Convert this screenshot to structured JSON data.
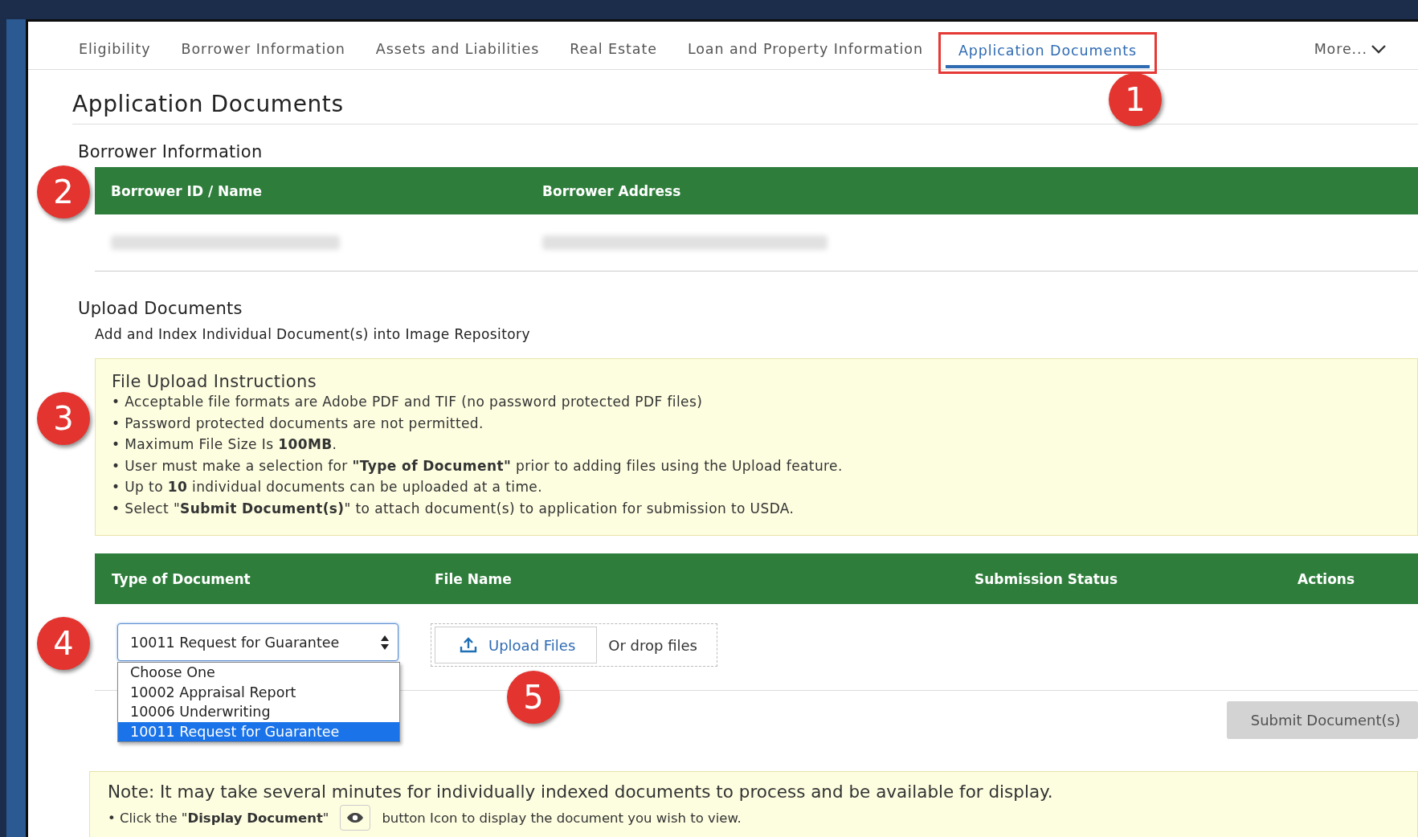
{
  "tabs": [
    {
      "label": "Eligibility",
      "selected": false,
      "highlighted": false
    },
    {
      "label": "Borrower Information",
      "selected": false,
      "highlighted": false
    },
    {
      "label": "Assets and Liabilities",
      "selected": false,
      "highlighted": false
    },
    {
      "label": "Real Estate",
      "selected": false,
      "highlighted": false
    },
    {
      "label": "Loan and Property Information",
      "selected": false,
      "highlighted": false
    },
    {
      "label": "Application Documents",
      "selected": true,
      "highlighted": true
    }
  ],
  "more_menu": {
    "label": "More..."
  },
  "page_title": "Application Documents",
  "borrower_section": {
    "title": "Borrower Information",
    "columns": [
      "Borrower ID / Name",
      "Borrower Address"
    ],
    "rows": [
      {
        "kind": "redacted"
      }
    ]
  },
  "upload_section": {
    "title": "Upload Documents",
    "subtitle": "Add and Index Individual Document(s) into Image Repository",
    "instructions": {
      "title": "File Upload Instructions",
      "items": [
        "• Acceptable file formats are Adobe PDF and TIF (no password protected PDF files)",
        "• Password protected documents are not permitted.",
        "• Maximum File Size Is **100MB**.",
        "• User must make a selection for **\"Type of Document\"** prior to adding files using the Upload feature.",
        "• Up to **10** individual documents can be uploaded at a time.",
        "• Select \"**Submit Document(s)**\" to attach document(s) to application for submission to USDA."
      ]
    },
    "columns": [
      "Type of Document",
      "File Name",
      "Submission Status",
      "Actions"
    ],
    "type_select": {
      "value": "10011 Request for Guarantee",
      "expanded": true,
      "options": [
        {
          "label": "Choose One",
          "selected": false
        },
        {
          "label": "10002 Appraisal Report",
          "selected": false
        },
        {
          "label": "10006 Underwriting",
          "selected": false
        },
        {
          "label": "10011 Request for Guarantee",
          "selected": true
        }
      ]
    },
    "upload_button": "Upload Files",
    "drop_hint": "Or drop files",
    "submit_button": {
      "label": "Submit Document(s)",
      "disabled": true
    }
  },
  "note": {
    "text": "Note: It may take several minutes for individually indexed documents to process and be available for display.",
    "hint_before": "• Click the \"**Display Document**\"",
    "hint_after": "button Icon to display the document you wish to view."
  },
  "callouts": [
    "1",
    "2",
    "3",
    "4",
    "5"
  ]
}
